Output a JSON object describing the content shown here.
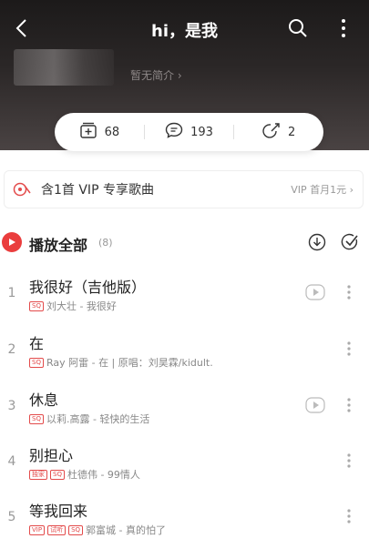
{
  "header": {
    "title": "hi，是我",
    "intro": "暂无简介 ›"
  },
  "stats": {
    "collect": "68",
    "comment": "193",
    "share": "2"
  },
  "vip_banner": {
    "text": "含1首 VIP 专享歌曲",
    "link": "VIP 首月1元 ›"
  },
  "playall": {
    "label": "播放全部",
    "count": "(8)"
  },
  "songs": [
    {
      "index": "1",
      "title": "我很好（吉他版）",
      "tags": [
        "SQ"
      ],
      "meta": "刘大壮 - 我很好",
      "has_mv": true
    },
    {
      "index": "2",
      "title": "在",
      "tags": [
        "SQ"
      ],
      "meta": "Ray 阿雷 - 在 | 原唱：刘昊霖/kidult.",
      "has_mv": false
    },
    {
      "index": "3",
      "title": "休息",
      "tags": [
        "SQ"
      ],
      "meta": "以莉.高露 - 轻快的生活",
      "has_mv": true
    },
    {
      "index": "4",
      "title": "别担心",
      "tags": [
        "独家",
        "SQ"
      ],
      "meta": "杜德伟 - 99情人",
      "has_mv": false
    },
    {
      "index": "5",
      "title": "等我回来",
      "tags": [
        "VIP",
        "试听",
        "SQ"
      ],
      "meta": "郭富城 - 真的怕了",
      "has_mv": false
    }
  ],
  "colors": {
    "accent": "#ea3d3d",
    "header_bg": "#2b2727"
  },
  "icons": [
    "back-icon",
    "search-icon",
    "more-icon",
    "collect-icon",
    "comment-icon",
    "share-icon",
    "vip-disc-icon",
    "play-icon",
    "download-icon",
    "multi-select-icon",
    "mv-icon"
  ]
}
